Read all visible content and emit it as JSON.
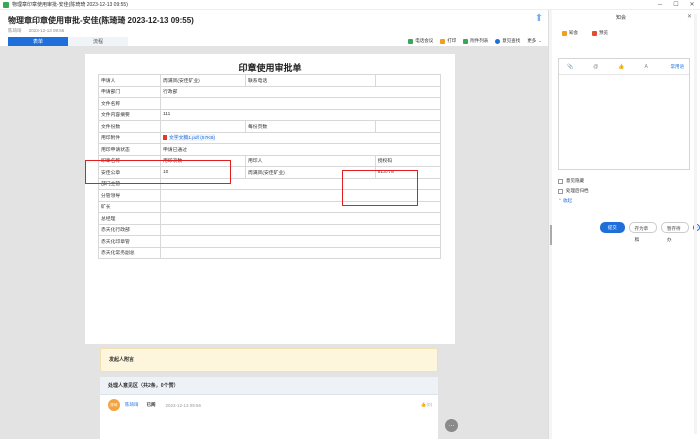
{
  "window": {
    "title": "物理章印章使用审批-安佳(陈琦琦 2023-12-13 09:55)"
  },
  "header": {
    "title": "物理章印章使用审批-安佳(陈琦琦 2023-12-13 09:55)",
    "author": "陈琦琦",
    "datetime": "2023-12-13 09:56",
    "tabs": [
      "表单",
      "流程"
    ],
    "actions": [
      {
        "label": "电话会议",
        "color": "#3aa757"
      },
      {
        "label": "打印",
        "color": "#f0a020"
      },
      {
        "label": "附件列表",
        "color": "#3aa757"
      },
      {
        "label": "意见查找",
        "color": "#1e6fd9"
      },
      {
        "label": "更多",
        "color": ""
      }
    ]
  },
  "form": {
    "title": "印章使用审批单",
    "applicant_label": "申请人",
    "applicant": "周满凤(安佳矿业)",
    "phone_label": "联系电话",
    "phone": "",
    "dept_label": "申请部门",
    "dept": "行政部",
    "doc_name_label": "文件名称",
    "doc_name": "",
    "doc_summary_label": "文件内容摘要",
    "doc_summary": "111",
    "copies_label": "文件份数",
    "copies": "",
    "pages_label": "每份页数",
    "pages": "",
    "attach_label": "用印附件",
    "attach": "文字文稿1.pdf (57KB)",
    "status_label": "用印申请状态",
    "status": "申请已通过",
    "seal_name_label": "印章名称",
    "seal_count_label": "用印次数",
    "seal_user_label": "用印人",
    "auth_code_label": "授权码",
    "seal_name": "安佳公章",
    "seal_count": "10",
    "seal_user": "周满凤(安佳矿业)",
    "auth_code": "813778",
    "sign_rows": [
      "部门主管",
      "分管领导",
      "矿长",
      "总经理",
      "赤天化行政部",
      "赤天化印章管",
      "赤天化常务副总"
    ]
  },
  "sponsor": {
    "title": "发起人附言"
  },
  "handler": {
    "title": "处理人意见区（共2条，0个赞）",
    "row1": {
      "avatar": "陈琦",
      "name": "陈琦琦",
      "state": "已阅",
      "time": "2023-12-13 09:56",
      "likes": "(0)"
    }
  },
  "right_panel": {
    "title": "知会",
    "tabs": [
      {
        "label": "知会",
        "color": "#f0a020"
      },
      {
        "label": "预览",
        "color": "#e05030"
      }
    ],
    "common_phrases": "常用语",
    "opt1": "意见隐藏",
    "opt2": "处理后归档",
    "collapse": "收起",
    "submit": "提交",
    "save_later": "存为草稿",
    "hold": "暂存待办"
  }
}
